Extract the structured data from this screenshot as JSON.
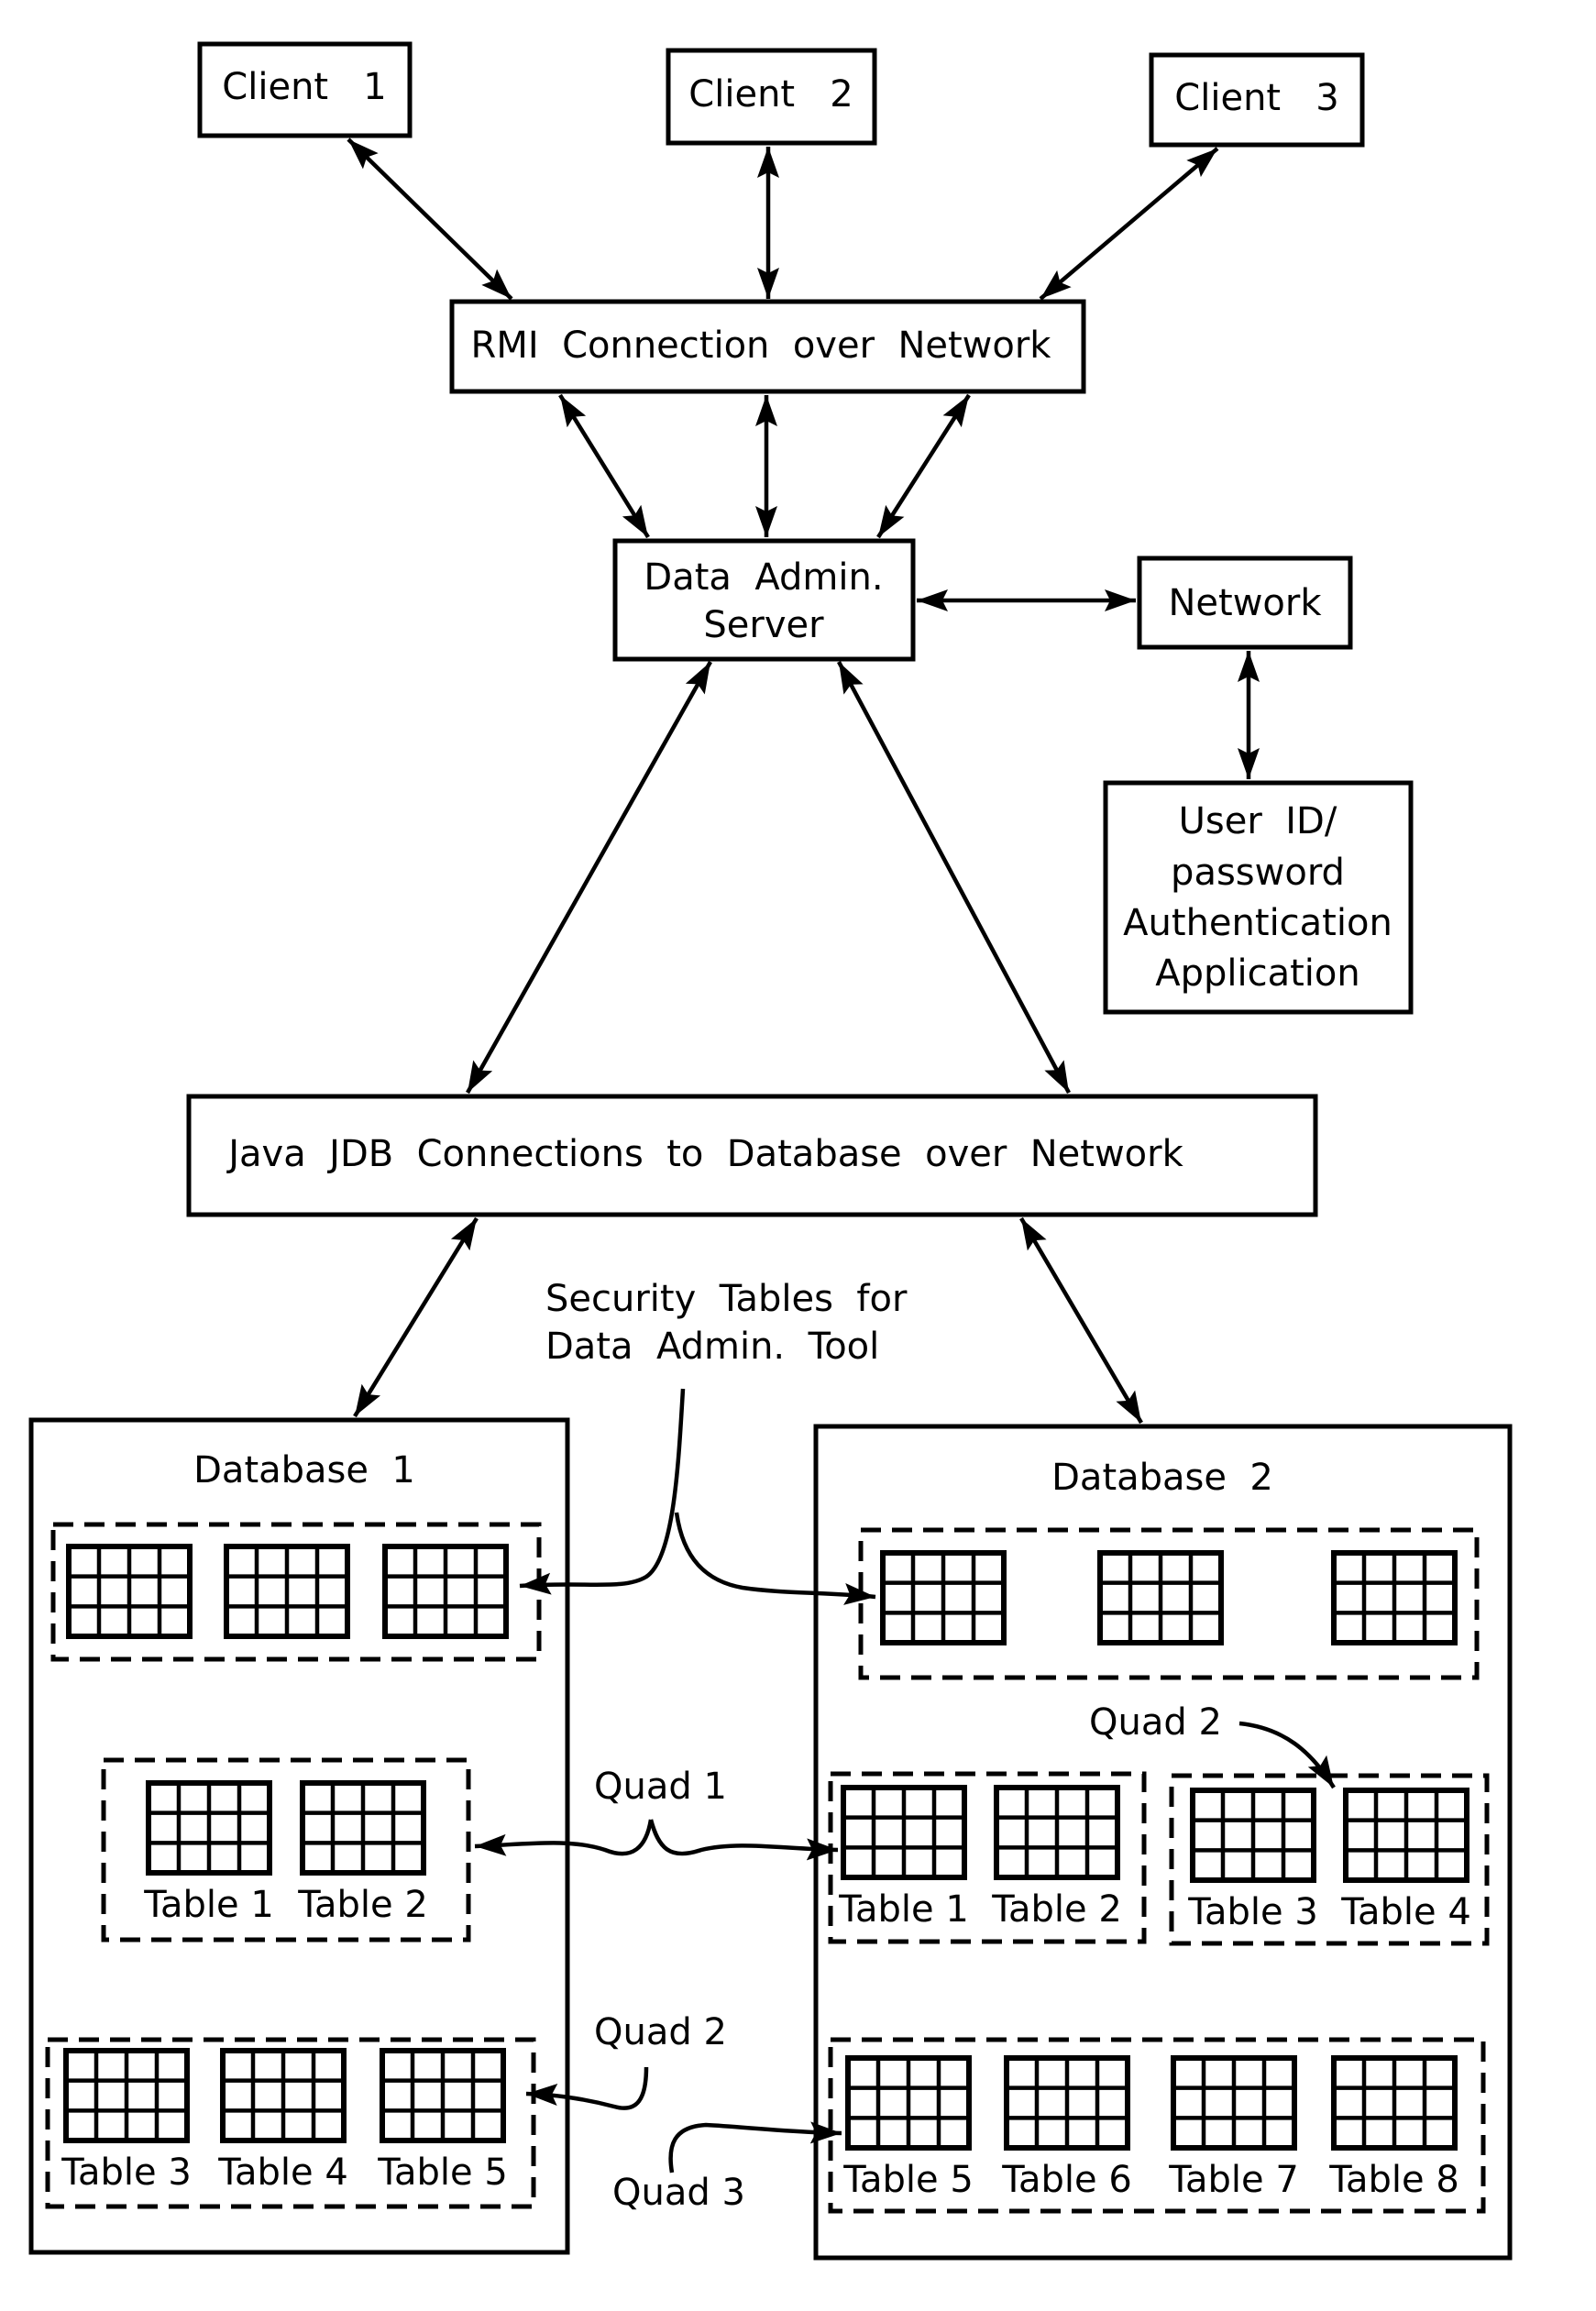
{
  "diagram": {
    "clients": [
      {
        "label": "Client   1"
      },
      {
        "label": "Client   2"
      },
      {
        "label": "Client   3"
      }
    ],
    "rmi": {
      "label": "RMI  Connection  over  Network"
    },
    "server": {
      "line1": "Data  Admin.",
      "line2": "Server"
    },
    "network": {
      "label": "Network"
    },
    "auth": {
      "line1": "User  ID/",
      "line2": "password",
      "line3": "Authentication",
      "line4": "Application"
    },
    "jdbc": {
      "label": "Java  JDB  Connections  to  Database  over  Network"
    },
    "security_note": {
      "line1": "Security  Tables  for",
      "line2": "Data  Admin.  Tool"
    },
    "database1": {
      "title": "Database  1",
      "quad1_tables": [
        "Table 1",
        "Table 2"
      ],
      "quad2_tables": [
        "Table 3",
        "Table 4",
        "Table 5"
      ]
    },
    "database2": {
      "title": "Database  2",
      "quad1_tables": [
        "Table 1",
        "Table 2"
      ],
      "quad2_tables": [
        "Table 3",
        "Table 4"
      ],
      "quad3_tables": [
        "Table 5",
        "Table 6",
        "Table 7",
        "Table 8"
      ]
    },
    "quad_labels": {
      "quad1": "Quad 1",
      "quad2_left": "Quad 2",
      "quad2_right": "Quad 2",
      "quad3": "Quad 3"
    },
    "grid": {
      "rows": 3,
      "cols": 4
    }
  }
}
